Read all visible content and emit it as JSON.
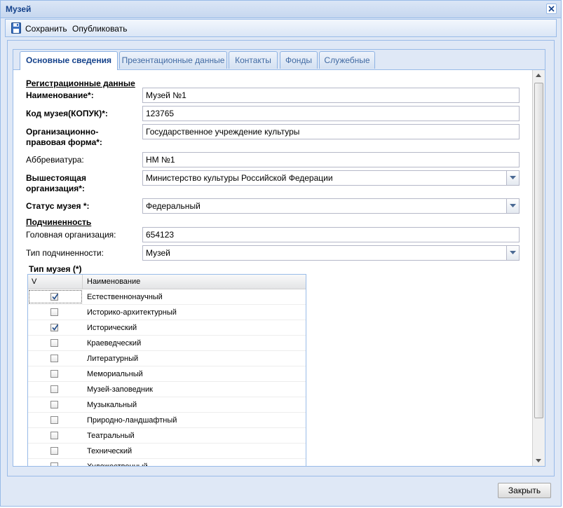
{
  "window": {
    "title": "Музей"
  },
  "toolbar": {
    "save_label": "Сохранить",
    "publish_label": "Опубликовать"
  },
  "tabs": [
    {
      "label": "Основные сведения",
      "active": true
    },
    {
      "label": "Презентационные данные"
    },
    {
      "label": "Контакты"
    },
    {
      "label": "Фонды"
    },
    {
      "label": "Служебные"
    }
  ],
  "form": {
    "section_registration": "Регистрационные данные",
    "name_label": "Наименование*:",
    "name_value": "Музей №1",
    "code_label": "Код музея(КОПУК)*:",
    "code_value": "123765",
    "legal_form_label": "Организационно-правовая форма*:",
    "legal_form_value": "Государственное учреждение культуры",
    "abbr_label": "Аббревиатура:",
    "abbr_value": "НМ №1",
    "parent_org_label": "Вышестоящая организация*:",
    "parent_org_value": "Министерство культуры Российской Федерации",
    "status_label": "Статус музея *:",
    "status_value": "Федеральный",
    "section_subordination": "Подчиненность",
    "head_org_label": "Головная организация:",
    "head_org_value": "654123",
    "sub_type_label": "Тип подчиненности:",
    "sub_type_value": "Музей",
    "museum_type_label": "Тип музея (*)"
  },
  "grid": {
    "col_check": "V",
    "col_name": "Наименование",
    "rows": [
      {
        "name": "Естественнонаучный",
        "checked": true
      },
      {
        "name": "Историко-архитектурный",
        "checked": false
      },
      {
        "name": "Исторический",
        "checked": true
      },
      {
        "name": "Краеведческий",
        "checked": false
      },
      {
        "name": "Литературный",
        "checked": false
      },
      {
        "name": "Мемориальный",
        "checked": false
      },
      {
        "name": "Музей-заповедник",
        "checked": false
      },
      {
        "name": "Музыкальный",
        "checked": false
      },
      {
        "name": "Природно-ландшафтный",
        "checked": false
      },
      {
        "name": "Театральный",
        "checked": false
      },
      {
        "name": "Технический",
        "checked": false
      },
      {
        "name": "Художественный",
        "checked": false
      }
    ]
  },
  "footer": {
    "close_label": "Закрыть"
  },
  "colors": {
    "accent": "#15428b",
    "border": "#99bbe8",
    "panel_bg": "#dfe8f6"
  },
  "icons": {
    "save": "floppy-disk-icon",
    "close": "close-icon",
    "combo": "chevron-down-icon",
    "checkbox": "checkmark-icon"
  }
}
